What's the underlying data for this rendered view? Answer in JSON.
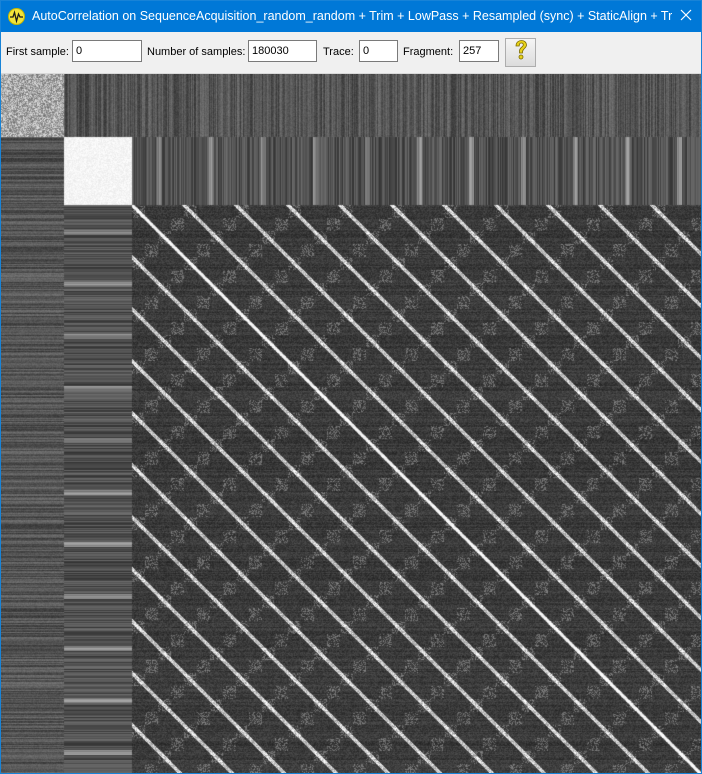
{
  "window": {
    "title": "AutoCorrelation on SequenceAcquisition_random_random + Trim + LowPass + Resampled (sync)  + StaticAlign + Trim ...",
    "icon": "waveform-app-icon",
    "close_icon": "close-icon",
    "accent_color": "#0078d7"
  },
  "toolbar": {
    "first_sample_label": "First sample:",
    "first_sample_value": "0",
    "num_samples_label": "Number of samples:",
    "num_samples_value": "180030",
    "trace_label": "Trace:",
    "trace_value": "0",
    "fragment_label": "Fragment:",
    "fragment_value": "257",
    "help_icon": "question-mark-icon"
  },
  "plot": {
    "type": "heatmap",
    "description_colors": {
      "background": "#3a3a3a",
      "high_correlation": "#ffffff",
      "low_correlation": "#2e2e2e"
    }
  }
}
